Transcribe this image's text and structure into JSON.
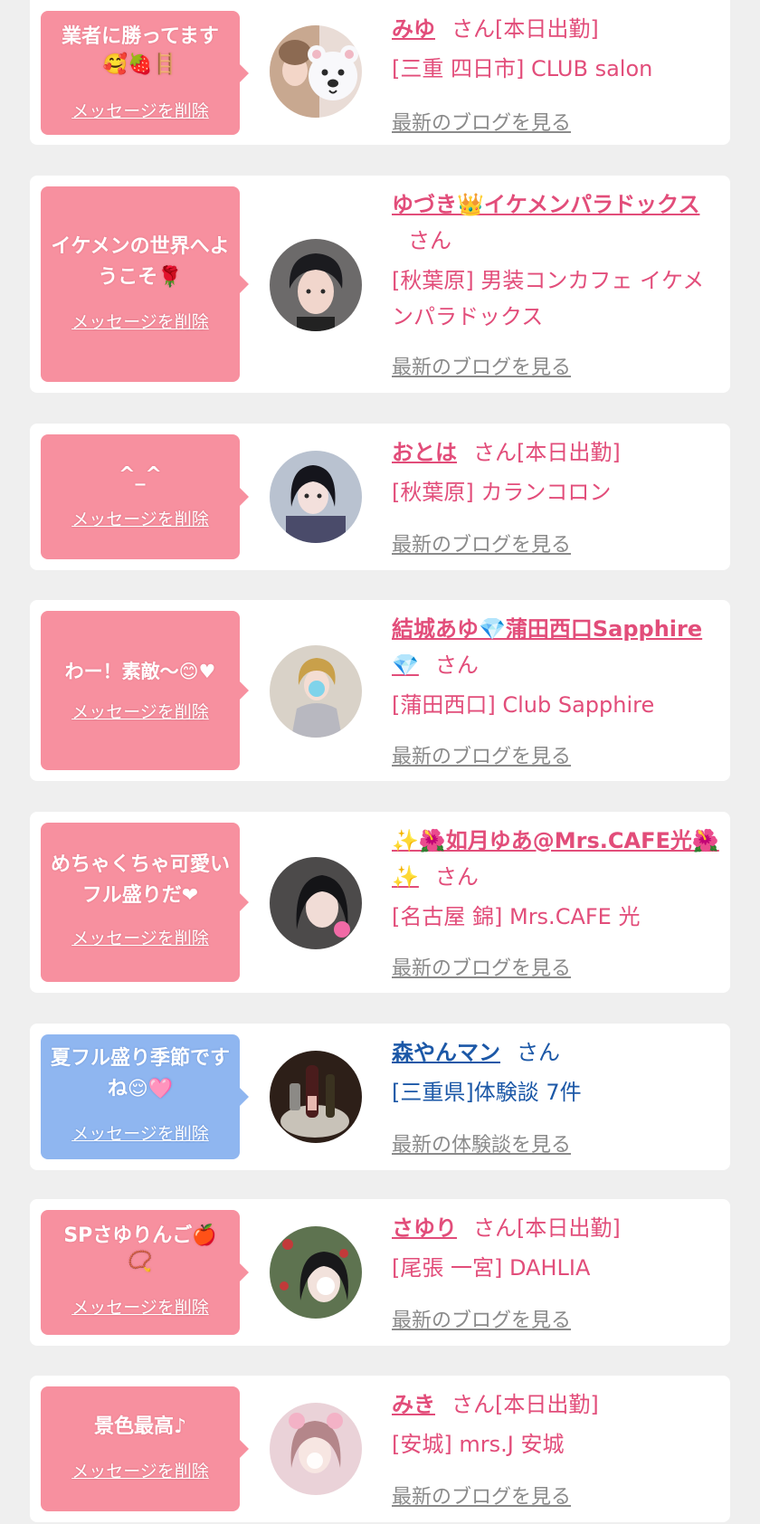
{
  "delete_label": "メッセージを削除",
  "suffix_san": "さん",
  "working_today": "[本日出勤]",
  "blog_link": "最新のブログを見る",
  "review_link": "最新の体験談を見る",
  "colors": {
    "pink_bubble": "#f7909f",
    "blue_bubble": "#8fb6f0",
    "name_pink": "#e24d7a",
    "name_blue": "#1c58a7",
    "link_gray": "#8a8a8a",
    "background": "#efefef"
  },
  "items": [
    {
      "message": "業者に勝ってます",
      "message_emoji": "🥰🍓🪜",
      "name": "みゆ",
      "status": "[本日出勤]",
      "shop": "[三重 四日市] CLUB salon",
      "link": "最新のブログを見る",
      "bubble": "pink"
    },
    {
      "message": "イケメンの世界へようこそ🌹",
      "name": "ゆづき👑イケメンパラドックス",
      "status": "",
      "shop": "[秋葉原] 男装コンカフェ イケメンパラドックス",
      "link": "最新のブログを見る",
      "bubble": "pink"
    },
    {
      "message": "^_^",
      "name": "おとは",
      "status": "[本日出勤]",
      "shop": "[秋葉原] カランコロン",
      "link": "最新のブログを見る",
      "bubble": "pink"
    },
    {
      "message": "わー！素敵〜😊♥",
      "name": "結城あゆ💎蒲田西口Sapphire💎",
      "status": "",
      "shop": "[蒲田西口] Club Sapphire",
      "link": "最新のブログを見る",
      "bubble": "pink"
    },
    {
      "message": "めちゃくちゃ可愛いフル盛りだ❤",
      "name": "✨🌺如月ゆあ@Mrs.CAFE光🌺✨",
      "status": "",
      "shop": "[名古屋 錦] Mrs.CAFE 光",
      "link": "最新のブログを見る",
      "bubble": "pink"
    },
    {
      "message": "夏フル盛り季節ですね😌🩷",
      "name": "森やんマン",
      "status": "",
      "shop": "[三重県]体験談 7件",
      "link": "最新の体験談を見る",
      "bubble": "blue"
    },
    {
      "message": "SPさゆりんご🍎",
      "message_emoji": "📿",
      "name": "さゆり",
      "status": "[本日出勤]",
      "shop": "[尾張 一宮] DAHLIA",
      "link": "最新のブログを見る",
      "bubble": "pink"
    },
    {
      "message": "景色最高♪",
      "name": "みき",
      "status": "[本日出勤]",
      "shop": "[安城] mrs.J 安城",
      "link": "最新のブログを見る",
      "bubble": "pink"
    }
  ]
}
